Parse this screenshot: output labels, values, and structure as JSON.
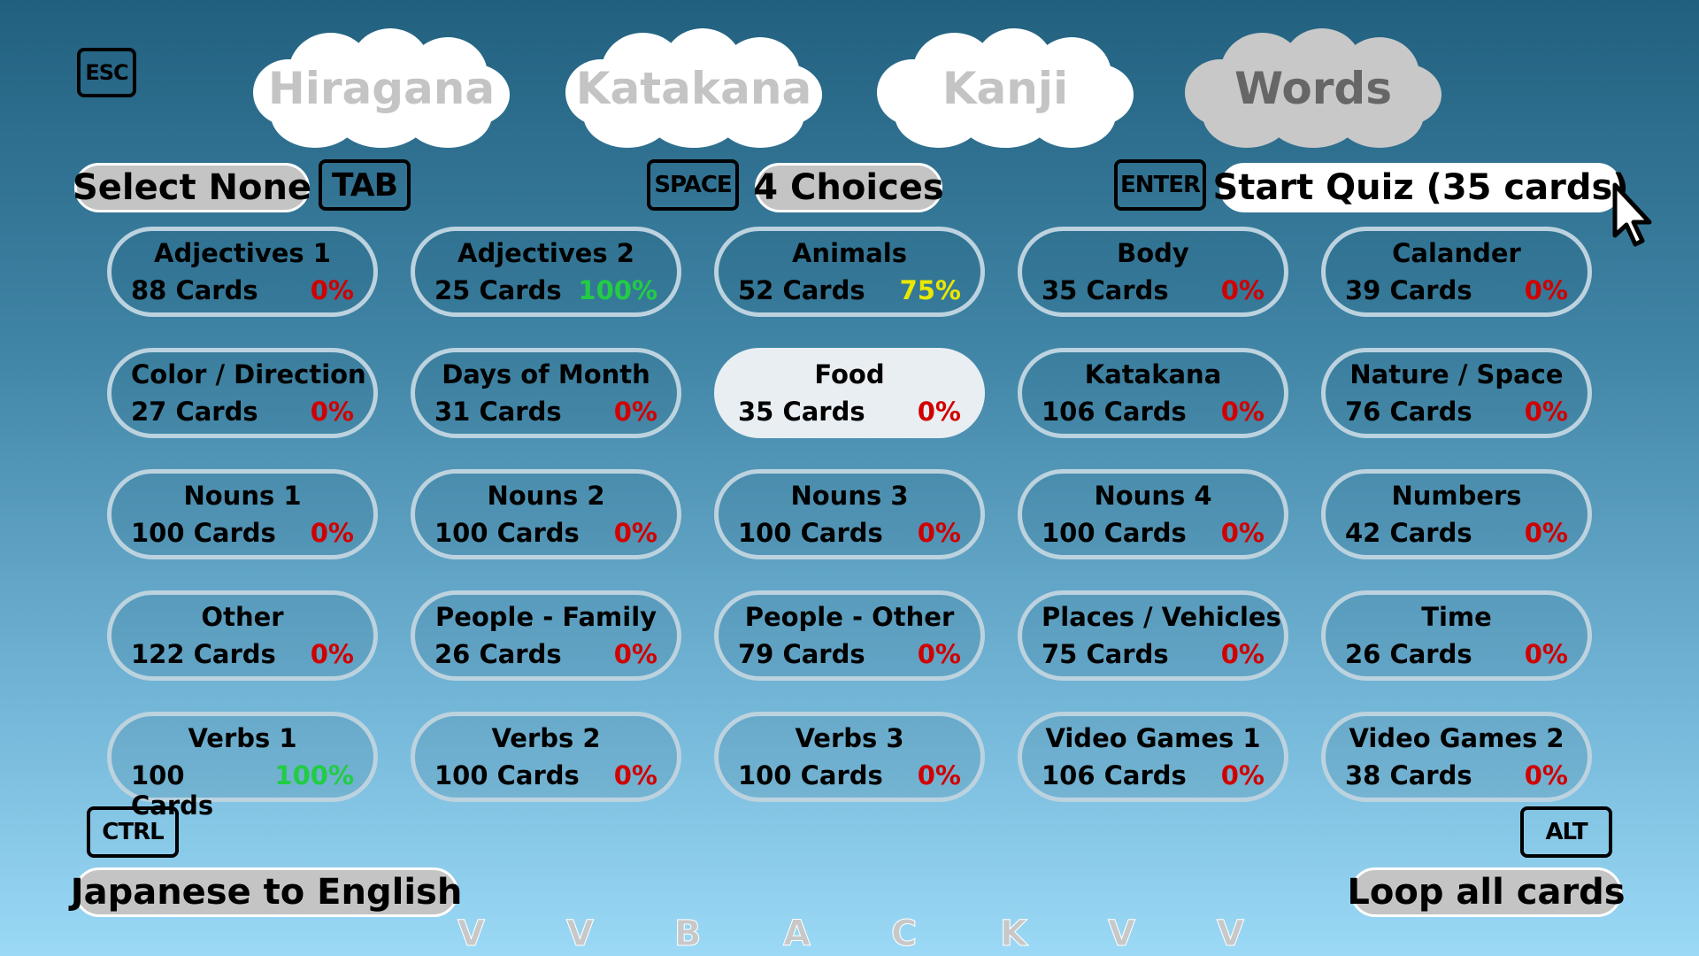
{
  "keys": {
    "esc": "ESC",
    "tab": "TAB",
    "space": "SPACE",
    "enter": "ENTER",
    "ctrl": "CTRL",
    "alt": "ALT"
  },
  "tabs": [
    {
      "label": "Hiragana",
      "active": false
    },
    {
      "label": "Katakana",
      "active": false
    },
    {
      "label": "Kanji",
      "active": false
    },
    {
      "label": "Words",
      "active": true
    }
  ],
  "controls": {
    "select_none": "Select None",
    "choices": "4 Choices",
    "start_quiz": "Start Quiz (35 cards)",
    "direction": "Japanese to English",
    "loop": "Loop all cards"
  },
  "colors": {
    "zero": "#d00000",
    "partial": "#e8e800",
    "complete": "#22cc44",
    "selected_card": "#e8eef2"
  },
  "decks": [
    {
      "name": "Adjectives 1",
      "cards": "88 Cards",
      "progress": "0%"
    },
    {
      "name": "Adjectives 2",
      "cards": "25 Cards",
      "progress": "100%"
    },
    {
      "name": "Animals",
      "cards": "52 Cards",
      "progress": "75%"
    },
    {
      "name": "Body",
      "cards": "35 Cards",
      "progress": "0%"
    },
    {
      "name": "Calander",
      "cards": "39 Cards",
      "progress": "0%"
    },
    {
      "name": "Color / Direction",
      "cards": "27 Cards",
      "progress": "0%"
    },
    {
      "name": "Days of Month",
      "cards": "31 Cards",
      "progress": "0%"
    },
    {
      "name": "Food",
      "cards": "35 Cards",
      "progress": "0%",
      "selected": true
    },
    {
      "name": "Katakana",
      "cards": "106 Cards",
      "progress": "0%"
    },
    {
      "name": "Nature / Space",
      "cards": "76 Cards",
      "progress": "0%"
    },
    {
      "name": "Nouns 1",
      "cards": "100 Cards",
      "progress": "0%"
    },
    {
      "name": "Nouns 2",
      "cards": "100 Cards",
      "progress": "0%"
    },
    {
      "name": "Nouns 3",
      "cards": "100 Cards",
      "progress": "0%"
    },
    {
      "name": "Nouns 4",
      "cards": "100 Cards",
      "progress": "0%"
    },
    {
      "name": "Numbers",
      "cards": "42 Cards",
      "progress": "0%"
    },
    {
      "name": "Other",
      "cards": "122 Cards",
      "progress": "0%"
    },
    {
      "name": "People - Family",
      "cards": "26 Cards",
      "progress": "0%"
    },
    {
      "name": "People - Other",
      "cards": "79 Cards",
      "progress": "0%"
    },
    {
      "name": "Places / Vehicles",
      "cards": "75 Cards",
      "progress": "0%"
    },
    {
      "name": "Time",
      "cards": "26 Cards",
      "progress": "0%"
    },
    {
      "name": "Verbs 1",
      "cards": "100 Cards",
      "progress": "100%"
    },
    {
      "name": "Verbs 2",
      "cards": "100 Cards",
      "progress": "0%"
    },
    {
      "name": "Verbs 3",
      "cards": "100 Cards",
      "progress": "0%"
    },
    {
      "name": "Video Games 1",
      "cards": "106 Cards",
      "progress": "0%"
    },
    {
      "name": "Video Games 2",
      "cards": "38 Cards",
      "progress": "0%"
    }
  ],
  "bottom_letters": [
    "V",
    "V",
    "B",
    "A",
    "C",
    "K",
    "V",
    "V"
  ],
  "cursor_icon": "arrow-cursor-icon"
}
